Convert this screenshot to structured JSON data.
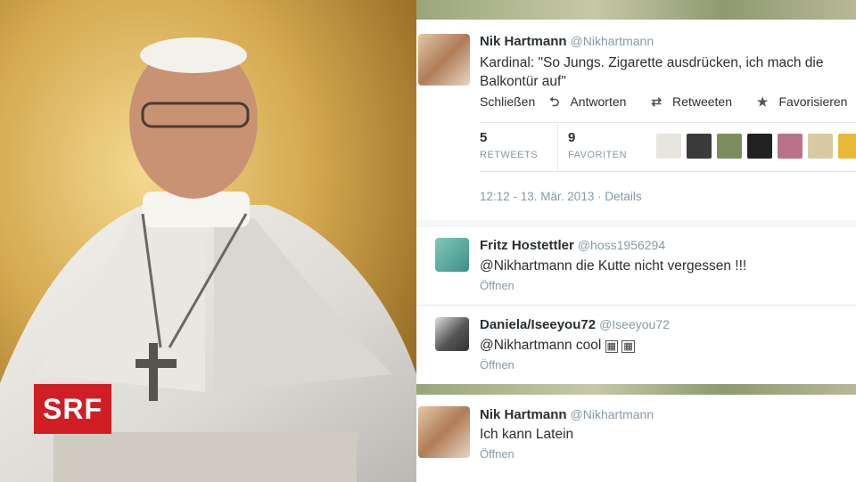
{
  "branding": {
    "logo_text": "SRF"
  },
  "main_tweet": {
    "name": "Nik Hartmann",
    "handle": "@Nikhartmann",
    "text_line1": "Kardinal: \"So Jungs. Zigarette ausdrücken, ich mach die",
    "text_line2": "Balkontür auf\"",
    "actions": {
      "close": "Schließen",
      "reply": "Antworten",
      "retweet": "Retweeten",
      "favorite": "Favorisieren",
      "more": "•••"
    },
    "stats": {
      "retweets_count": "5",
      "retweets_label": "RETWEETS",
      "favorites_count": "9",
      "favorites_label": "FAVORITEN"
    },
    "timestamp": "12:12 - 13. Mär. 2013",
    "details": "Details"
  },
  "replies": [
    {
      "name": "Fritz Hostettler",
      "handle": "@hoss1956294",
      "text": "@Nikhartmann die Kutte nicht vergessen !!!",
      "open": "Öffnen"
    },
    {
      "name": "Daniela/Iseeyou72",
      "handle": "@Iseeyou72",
      "text": "@Nikhartmann cool ",
      "open": "Öffnen"
    }
  ],
  "last_tweet": {
    "name": "Nik Hartmann",
    "handle": "@Nikhartmann",
    "text": "Ich kann Latein",
    "open": "Öffnen"
  },
  "colors": {
    "srf_red": "#cf1f24",
    "muted": "#8899a6",
    "text": "#292f33"
  },
  "icons": [
    "reply-icon",
    "retweet-icon",
    "star-icon",
    "more-icon"
  ]
}
